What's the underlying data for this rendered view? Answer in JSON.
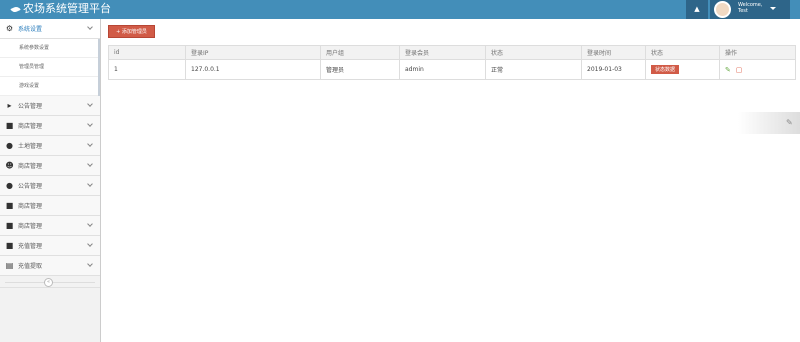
{
  "header": {
    "title": "农场系统管理平台",
    "welcome": "Welcome,",
    "username": "Test"
  },
  "sidebar": {
    "system_settings": "系统设置",
    "submenu": [
      "系统参数设置",
      "管理员管理",
      "游戏设置"
    ],
    "items": [
      "公告管理",
      "商店管理",
      "土地管理",
      "商店管理",
      "公告管理",
      "商店管理",
      "商店管理",
      "充值管理",
      "充值提取"
    ]
  },
  "toolbar": {
    "add_label": "添加管理员"
  },
  "table": {
    "headers": [
      "id",
      "登录IP",
      "用户组",
      "登录会员",
      "状态",
      "登录时间",
      "状态",
      "操作"
    ],
    "rows": [
      {
        "id": "1",
        "ip": "127.0.0.1",
        "group": "管理员",
        "member": "admin",
        "state": "正常",
        "time": "2019-01-03",
        "badge": "状态数据"
      }
    ]
  },
  "colors": {
    "topbar": "#438eb9",
    "accent": "#d15b47",
    "sidebar_active": "#2b7dbc"
  },
  "icons": {
    "edit": "pencil-icon",
    "delete": "trash-icon"
  }
}
